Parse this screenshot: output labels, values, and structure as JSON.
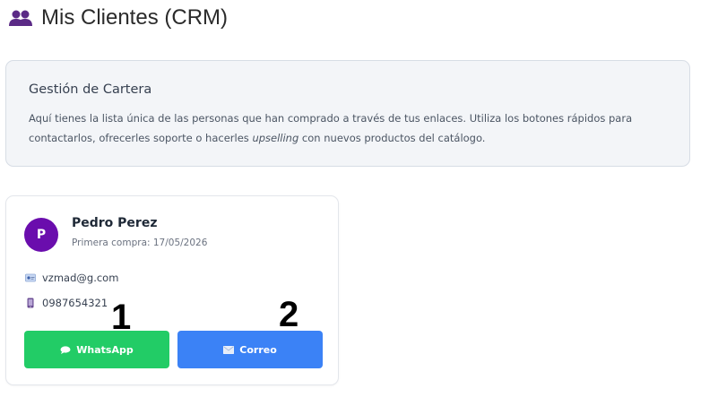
{
  "page": {
    "title": "Mis Clientes (CRM)",
    "title_icon": "users-icon"
  },
  "info": {
    "heading": "Gestión de Cartera",
    "text_before": "Aquí tienes la lista única de las personas que han comprado a través de tus enlaces. Utiliza los botones rápidos para contactarlos, ofrecerles soporte o hacerles ",
    "text_emphasis": "upselling",
    "text_after": " con nuevos productos del catálogo."
  },
  "client": {
    "avatar_initial": "P",
    "name": "Pedro Perez",
    "first_purchase": "Primera compra: 17/05/2026",
    "email": "vzmad@g.com",
    "email_icon": "id-card-icon",
    "phone": "0987654321",
    "phone_icon": "phone-icon",
    "whatsapp_label": "WhatsApp",
    "whatsapp_icon": "chat-bubble-icon",
    "email_button_label": "Correo",
    "email_button_icon": "envelope-icon"
  },
  "annotations": {
    "marker_1": "1",
    "marker_2": "2"
  },
  "colors": {
    "avatar": "#6a0dad",
    "whatsapp_button": "#22cc66",
    "email_button": "#3b82f6",
    "info_background": "#f3f5f8"
  }
}
